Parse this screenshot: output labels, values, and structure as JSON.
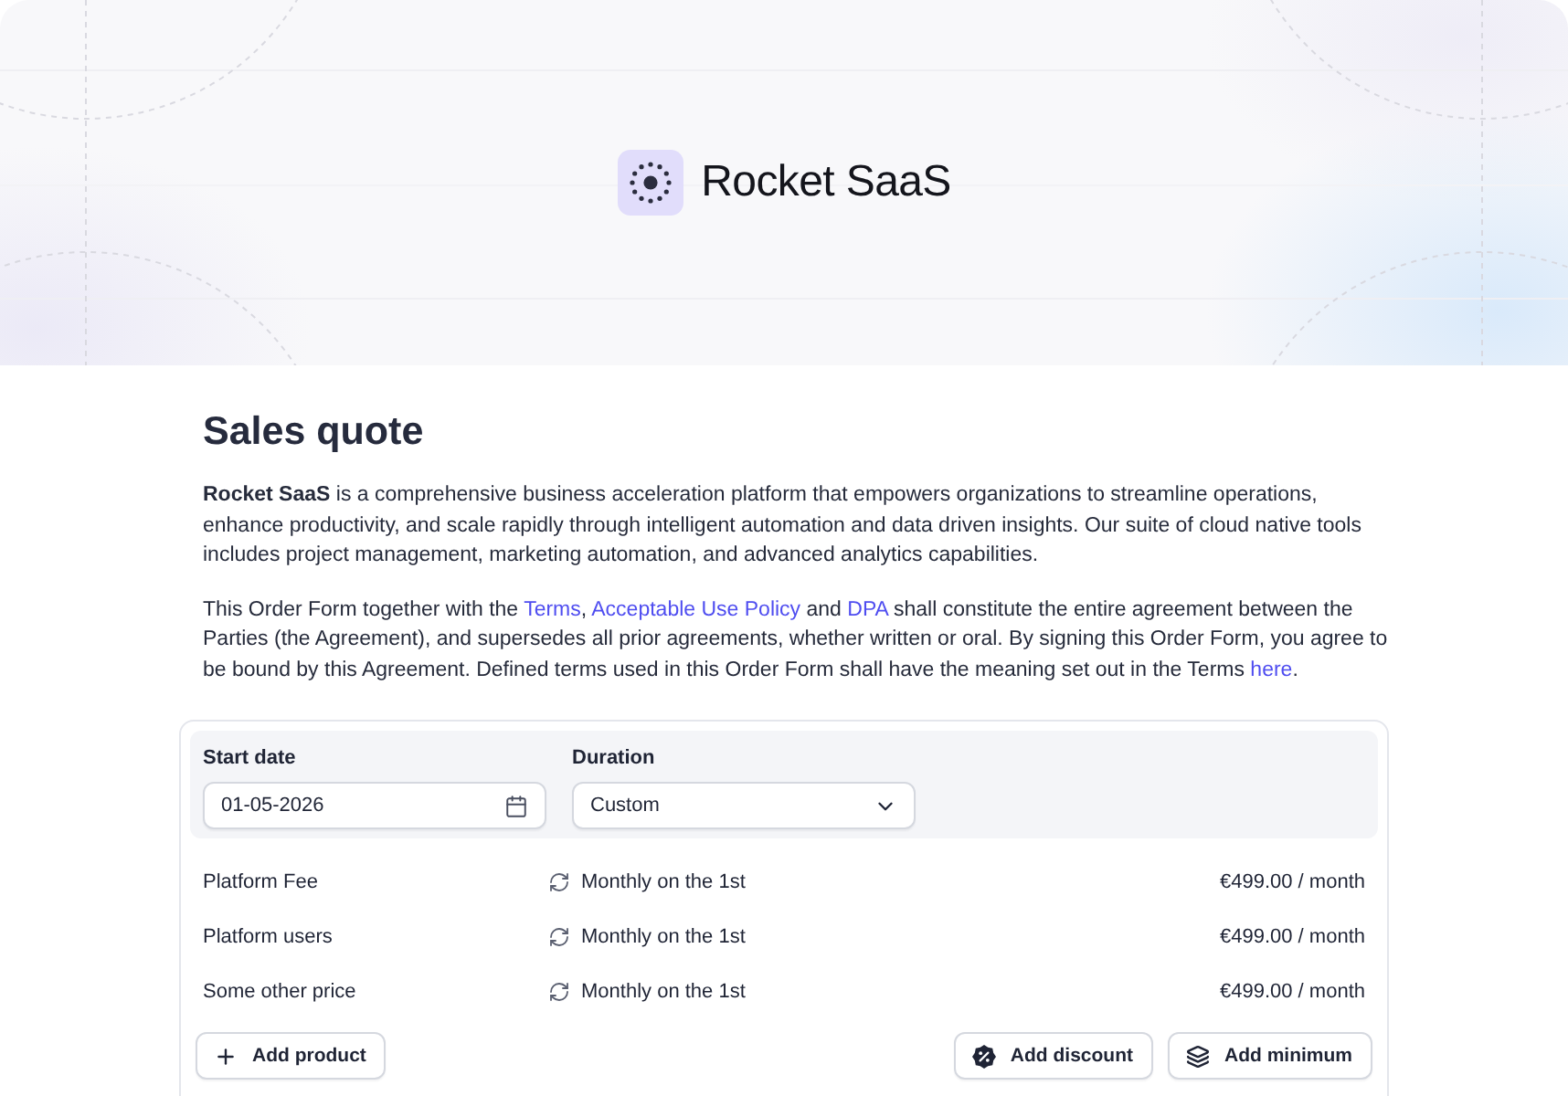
{
  "brand": {
    "name": "Rocket SaaS"
  },
  "title": "Sales quote",
  "intro": "**Rocket SaaS** is a comprehensive business acceleration platform that empowers organizations to streamline operations, enhance productivity, and scale rapidly through intelligent automation and data driven insights. Our suite of cloud native tools includes project management, marketing automation, and advanced analytics capabilities.",
  "agreement": [
    {
      "kind": "text",
      "text": "This Order Form together with the "
    },
    {
      "kind": "link",
      "text": "Terms"
    },
    {
      "kind": "text",
      "text": ", "
    },
    {
      "kind": "link",
      "text": "Acceptable Use Policy"
    },
    {
      "kind": "text",
      "text": " and "
    },
    {
      "kind": "link",
      "text": "DPA"
    },
    {
      "kind": "text",
      "text": " shall constitute the entire agreement between the Parties (the Agreement), and supersedes all prior agreements, whether written or oral. By signing this Order Form, you agree to be bound by this Agreement. Defined terms used in this Order Form shall have the meaning set out in the Terms "
    },
    {
      "kind": "link",
      "text": "here"
    },
    {
      "kind": "text",
      "text": "."
    }
  ],
  "form": {
    "fields": [
      {
        "kind": "date",
        "label": "Start date",
        "value": "01-05-2026"
      },
      {
        "kind": "select",
        "label": "Duration",
        "value": "Custom"
      }
    ]
  },
  "line_items": [
    {
      "name": "Platform Fee",
      "schedule": "Monthly on the 1st",
      "price": "€499.00 / month"
    },
    {
      "name": "Platform users",
      "schedule": "Monthly on the 1st",
      "price": "€499.00 / month"
    },
    {
      "name": "Some other price",
      "schedule": "Monthly on the 1st",
      "price": "€499.00 / month"
    }
  ],
  "actions": {
    "start": [
      {
        "kind": "product",
        "label": "Add product"
      }
    ],
    "end": [
      {
        "kind": "discount",
        "label": "Add discount"
      },
      {
        "kind": "minimum",
        "label": "Add minimum"
      }
    ]
  }
}
